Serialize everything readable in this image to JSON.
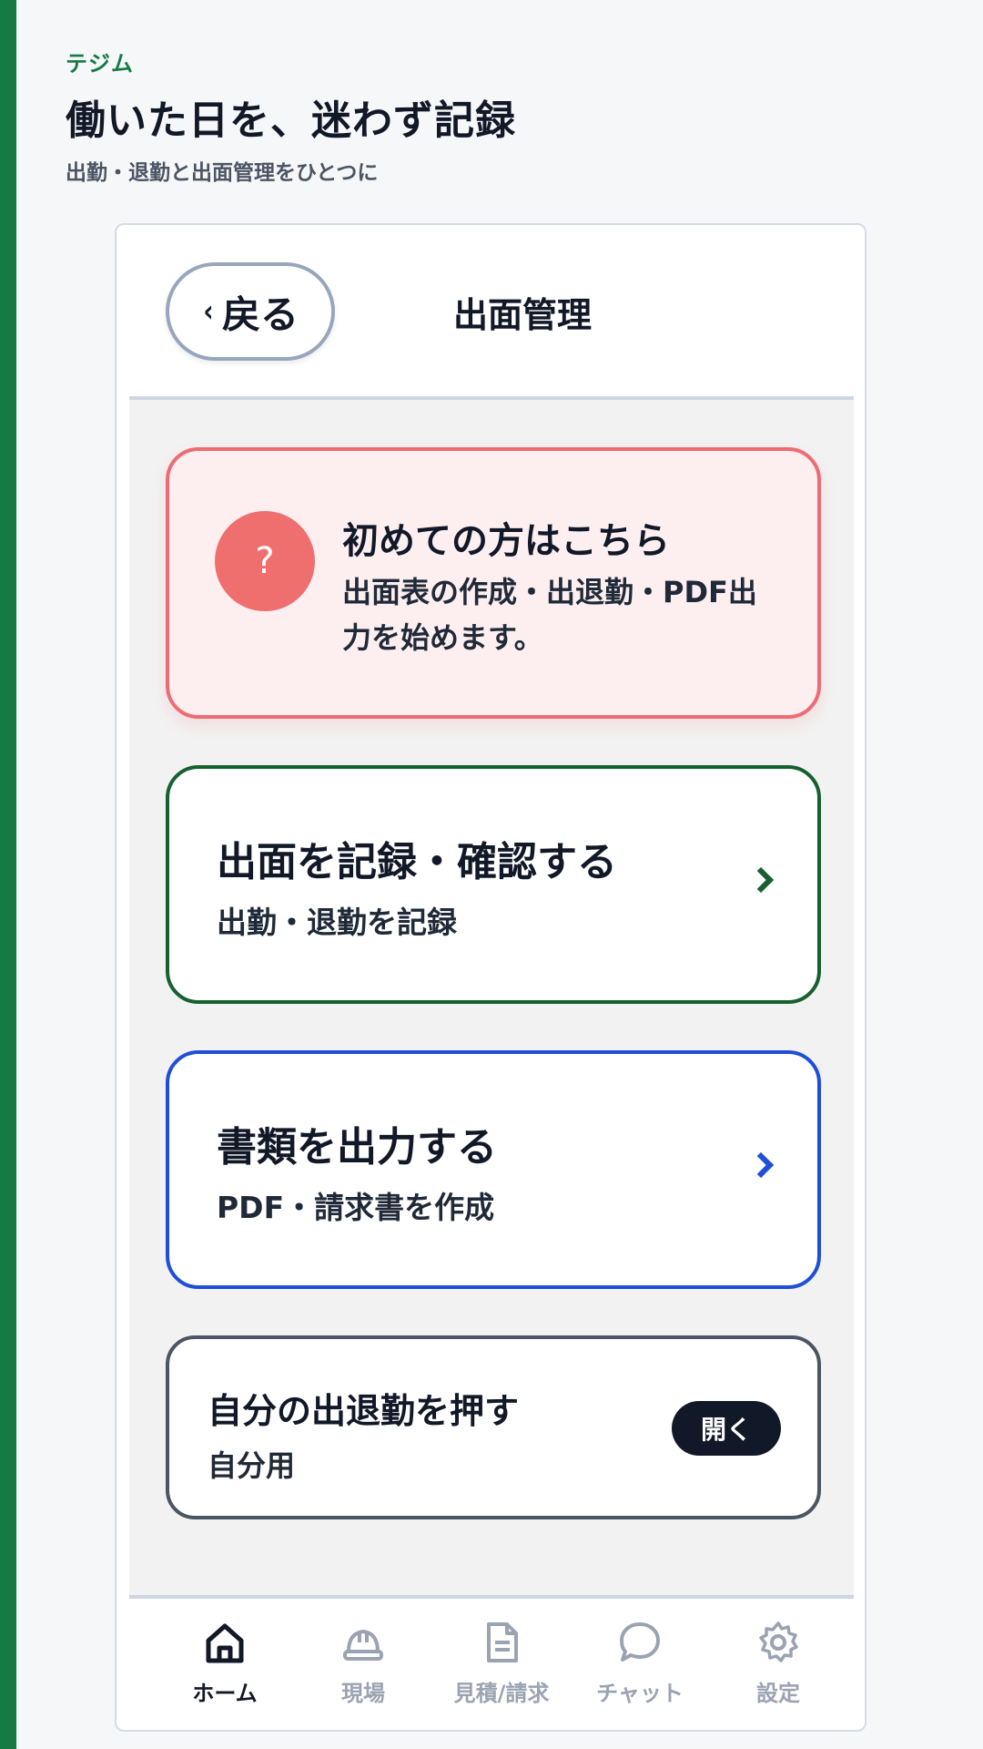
{
  "app": {
    "brand": "テジム",
    "headline": "働いた日を、迷わず記録",
    "subline": "出勤・退勤と出面管理をひとつに"
  },
  "header": {
    "back_chevron": "‹",
    "back_label": "戻る",
    "title": "出面管理"
  },
  "guide_card": {
    "icon": "?",
    "title": "初めての方はこちら",
    "description": "出面表の作成・出退勤・PDF出力を始めます。"
  },
  "menu": [
    {
      "title": "出面を記録・確認する",
      "subtitle": "出勤・退勤を記録",
      "accent": "#17602f"
    },
    {
      "title": "書類を出力する",
      "subtitle": "PDF・請求書を作成",
      "accent": "#1f4fd8"
    }
  ],
  "punch_card": {
    "title": "自分の出退勤を押す",
    "subtitle": "自分用",
    "button_label": "開く"
  },
  "tabs": [
    {
      "label": "ホーム",
      "icon": "home-icon",
      "active": true
    },
    {
      "label": "現場",
      "icon": "hardhat-icon",
      "active": false
    },
    {
      "label": "見積/請求",
      "icon": "document-icon",
      "active": false
    },
    {
      "label": "チャット",
      "icon": "chat-icon",
      "active": false
    },
    {
      "label": "設定",
      "icon": "gear-icon",
      "active": false
    }
  ],
  "colors": {
    "brand_green": "#167a45",
    "guide_red": "#ef6b73",
    "record_green": "#17602f",
    "output_blue": "#1f4fd8",
    "tab_active": "#111827",
    "tab_inactive": "#9aa3b2"
  }
}
